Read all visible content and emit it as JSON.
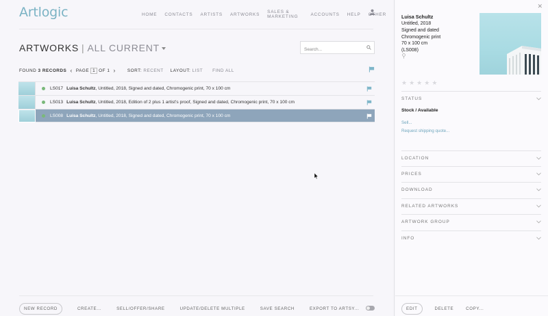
{
  "app": {
    "logo": "Artlogic"
  },
  "nav": {
    "items": [
      "HOME",
      "CONTACTS",
      "ARTISTS",
      "ARTWORKS",
      "SALES & MARKETING",
      "ACCOUNTS",
      "HELP",
      "OTHER"
    ]
  },
  "header": {
    "title": "ARTWORKS",
    "separator": "|",
    "subtitle": "ALL CURRENT"
  },
  "search": {
    "placeholder": "Search..."
  },
  "toolbar": {
    "found_prefix": "FOUND",
    "found_count": "3 RECORDS",
    "page_label": "PAGE",
    "page_current": "1",
    "page_of": "OF 1",
    "sort_label": "SORT:",
    "sort_value": "RECENT",
    "layout_label": "LAYOUT:",
    "layout_value": "LIST",
    "find_all": "FIND ALL"
  },
  "records": [
    {
      "ref": "LS017",
      "artist": "Luisa Schultz",
      "details": ", Untitled, 2018, Signed and dated, Chromogenic print, 70 x 100 cm",
      "selected": false
    },
    {
      "ref": "LS013",
      "artist": "Luisa Schultz",
      "details": ", Untitled, 2018, Edition of 2 plus 1 artist's proof, Signed and dated, Chromogenic print, 70 x 100 cm",
      "selected": false
    },
    {
      "ref": "LS008",
      "artist": "Luisa Schultz",
      "details": ", Untitled, 2018, Signed and dated, Chromogenic print, 70 x 100 cm",
      "selected": true
    }
  ],
  "bottom_bar": {
    "new_record": "NEW RECORD",
    "actions": [
      "CREATE...",
      "SELL/OFFER/SHARE",
      "UPDATE/DELETE MULTIPLE",
      "SAVE SEARCH",
      "EXPORT TO ARTSY..."
    ]
  },
  "panel": {
    "artist": "Luisa Schultz",
    "title_year": "Untitled, 2018",
    "signature": "Signed and dated",
    "medium": "Chromogenic print",
    "dimensions": "70 x 100 cm",
    "ref": "(LS008)",
    "status_heading": "STATUS",
    "status_value": "Stock / Available",
    "sell_link": "Sell...",
    "shipping_link": "Request shipping quote...",
    "sections": [
      "LOCATION",
      "PRICES",
      "DOWNLOAD",
      "RELATED ARTWORKS",
      "ARTWORK GROUP",
      "INFO"
    ],
    "edit": "EDIT",
    "delete": "DELETE",
    "copy": "COPY..."
  },
  "colors": {
    "accent": "#7bb3c4",
    "selected_row": "#8ea5bb",
    "status_dot": "#7ab87a",
    "link": "#6fa6bd"
  }
}
